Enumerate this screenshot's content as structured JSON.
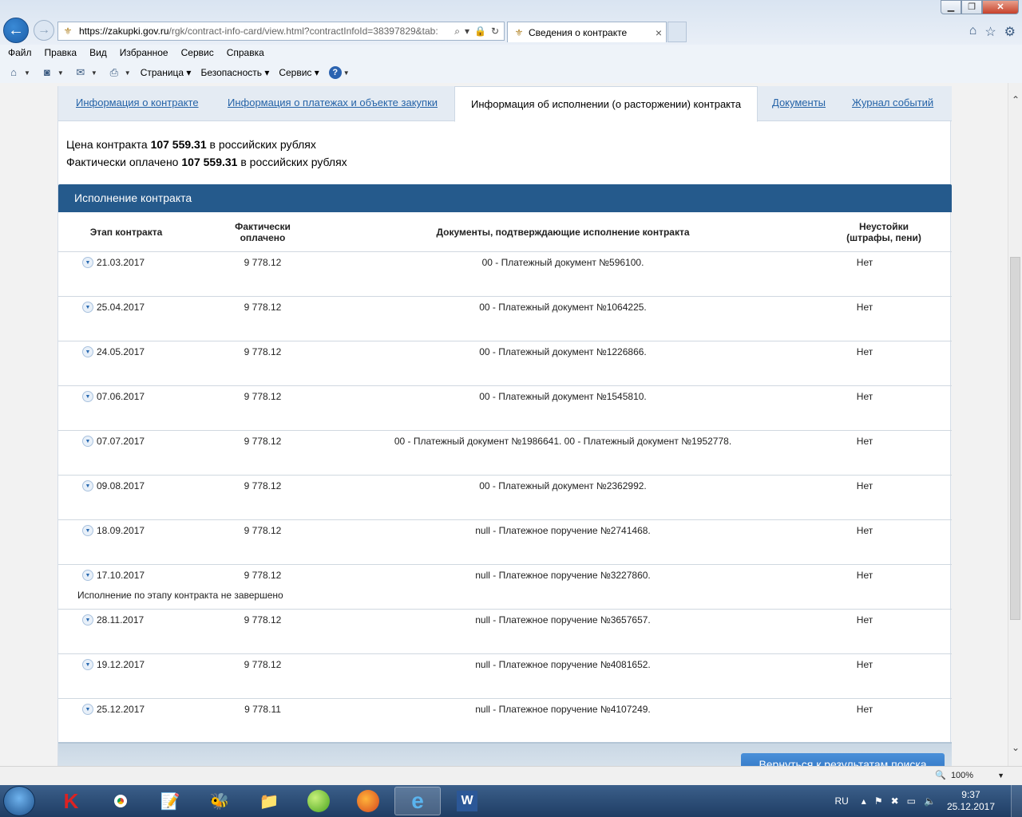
{
  "browser": {
    "url_host": "https://zakupki.gov.ru",
    "url_path": "/rgk/contract-info-card/view.html?contractInfoId=38397829&tab:",
    "tab_title": "Сведения о контракте",
    "tab_close": "×",
    "menu": [
      "Файл",
      "Правка",
      "Вид",
      "Избранное",
      "Сервис",
      "Справка"
    ],
    "commands": {
      "page": "Страница",
      "safety": "Безопасность",
      "tools": "Сервис"
    }
  },
  "page": {
    "tabs": [
      "Информация о контракте",
      "Информация о платежах и объекте закупки",
      "Информация об исполнении (о расторжении) контракта",
      "Документы",
      "Журнал событий"
    ],
    "price": {
      "label": "Цена контракта",
      "value": "107 559.31",
      "currency": "в российских рублях"
    },
    "paid": {
      "label": "Фактически оплачено",
      "value": "107 559.31",
      "currency": "в российских рублях"
    },
    "section_title": "Исполнение контракта",
    "columns": {
      "stage": "Этап контракта",
      "paid_line1": "Фактически",
      "paid_line2": "оплачено",
      "documents": "Документы, подтверждающие исполнение контракта",
      "penalty_line1": "Неустойки",
      "penalty_line2": "(штрафы, пени)"
    },
    "rows": [
      {
        "date": "21.03.2017",
        "paid": "9 778.12",
        "docs": "00 - Платежный документ №596100.",
        "penalty": "Нет",
        "note": ""
      },
      {
        "date": "25.04.2017",
        "paid": "9 778.12",
        "docs": "00 - Платежный документ №1064225.",
        "penalty": "Нет",
        "note": ""
      },
      {
        "date": "24.05.2017",
        "paid": "9 778.12",
        "docs": "00 - Платежный документ №1226866.",
        "penalty": "Нет",
        "note": ""
      },
      {
        "date": "07.06.2017",
        "paid": "9 778.12",
        "docs": "00 - Платежный документ №1545810.",
        "penalty": "Нет",
        "note": ""
      },
      {
        "date": "07.07.2017",
        "paid": "9 778.12",
        "docs": "00 - Платежный документ №1986641. 00 - Платежный документ №1952778.",
        "penalty": "Нет",
        "note": ""
      },
      {
        "date": "09.08.2017",
        "paid": "9 778.12",
        "docs": "00 - Платежный документ №2362992.",
        "penalty": "Нет",
        "note": ""
      },
      {
        "date": "18.09.2017",
        "paid": "9 778.12",
        "docs": "null - Платежное поручение №2741468.",
        "penalty": "Нет",
        "note": ""
      },
      {
        "date": "17.10.2017",
        "paid": "9 778.12",
        "docs": "null - Платежное поручение №3227860.",
        "penalty": "Нет",
        "note": "Исполнение по этапу контракта не завершено"
      },
      {
        "date": "28.11.2017",
        "paid": "9 778.12",
        "docs": "null - Платежное поручение №3657657.",
        "penalty": "Нет",
        "note": ""
      },
      {
        "date": "19.12.2017",
        "paid": "9 778.12",
        "docs": "null - Платежное поручение №4081652.",
        "penalty": "Нет",
        "note": ""
      },
      {
        "date": "25.12.2017",
        "paid": "9 778.11",
        "docs": "null - Платежное поручение №4107249.",
        "penalty": "Нет",
        "note": ""
      }
    ],
    "back_button": "Вернуться к результатам поиска"
  },
  "status": {
    "zoom": "100%"
  },
  "taskbar": {
    "lang": "RU",
    "time": "9:37",
    "date": "25.12.2017"
  },
  "colors": {
    "section_header": "#255a8c",
    "link": "#2563a7"
  }
}
